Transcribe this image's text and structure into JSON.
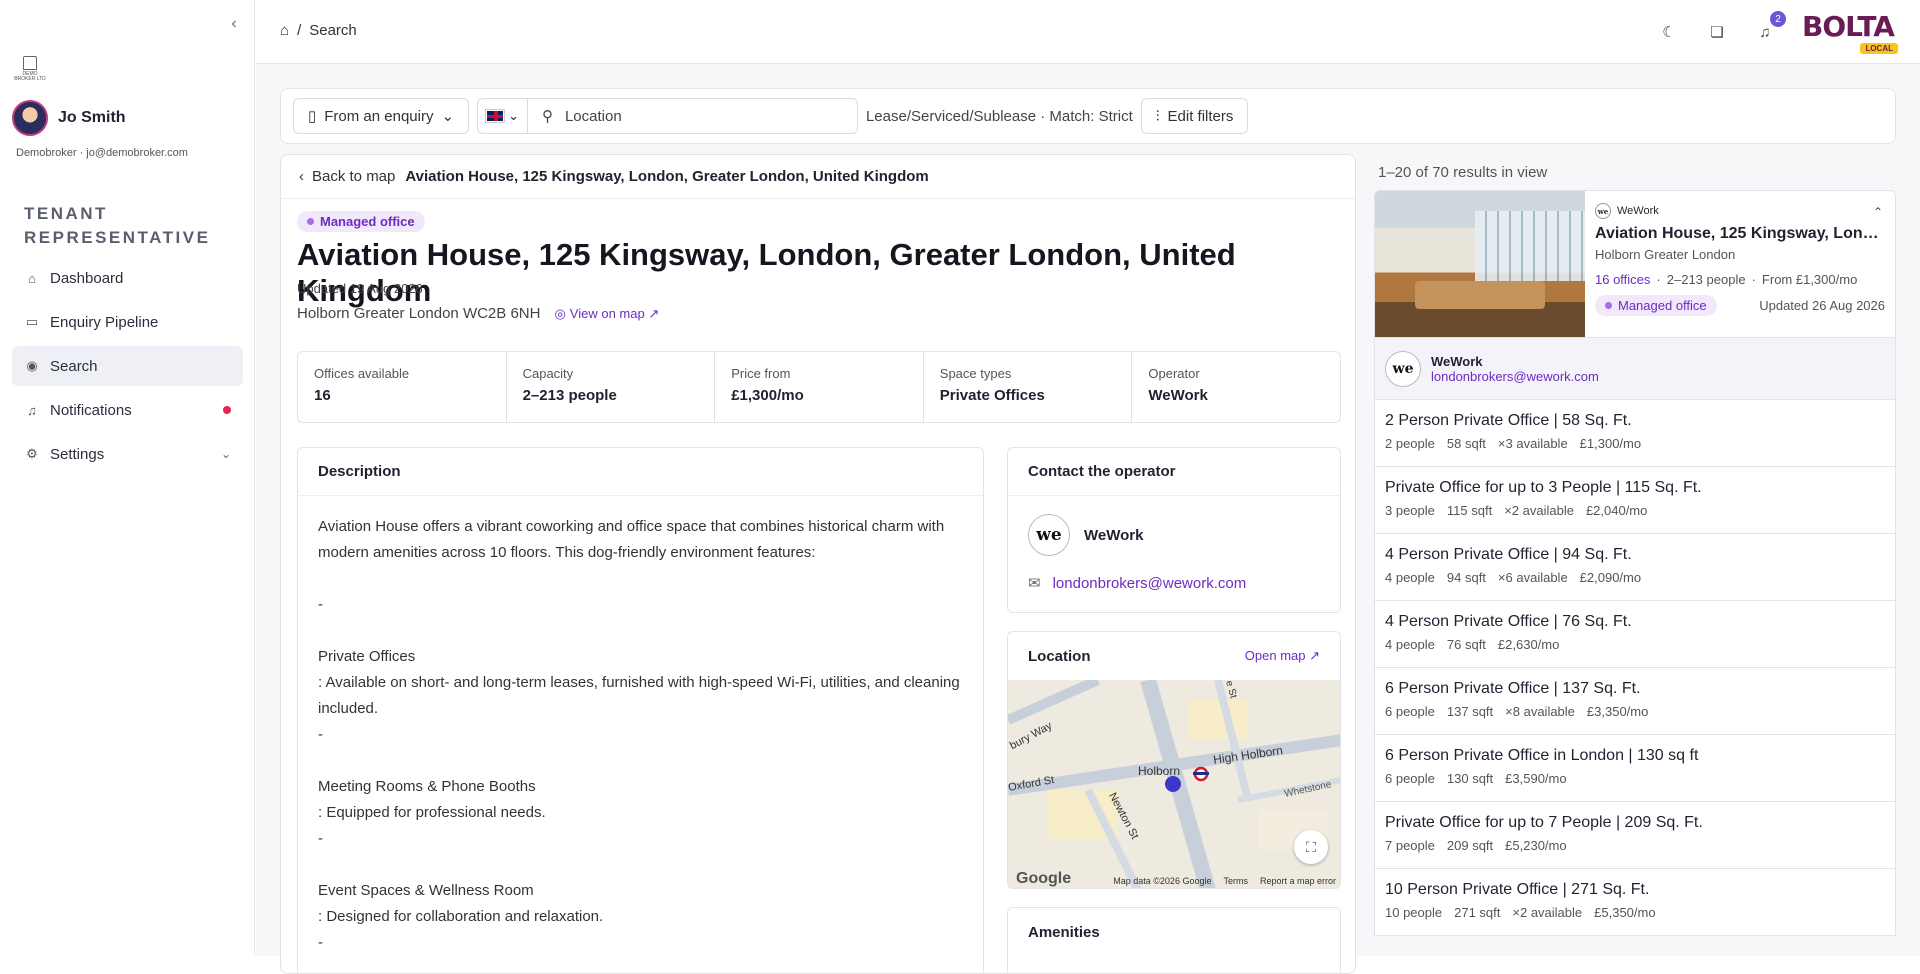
{
  "sidebar": {
    "brand_text": "DEMO BROKER LTD",
    "user_name": "Jo Smith",
    "user_email": "Demobroker · jo@demobroker.com",
    "section_title": "TENANT REPRESENTATIVE",
    "items": [
      {
        "label": "Dashboard",
        "icon": "home-icon"
      },
      {
        "label": "Enquiry Pipeline",
        "icon": "document-icon"
      },
      {
        "label": "Search",
        "icon": "location-pin-icon"
      },
      {
        "label": "Notifications",
        "icon": "bell-icon"
      },
      {
        "label": "Settings",
        "icon": "gear-icon"
      }
    ]
  },
  "topbar": {
    "breadcrumb_current": "Search",
    "notification_count": "2",
    "logo_word": "BOLTA",
    "logo_badge": "LOCAL"
  },
  "filters": {
    "enquiry_label": "From an enquiry",
    "location_placeholder": "Location",
    "summary": "Lease/Serviced/Sublease · Match: Strict",
    "edit_label": "Edit filters"
  },
  "detail": {
    "back_label": "Back to map",
    "back_address": "Aviation House, 125 Kingsway, London, Greater London, United Kingdom",
    "tag": "Managed office",
    "title": "Aviation House, 125 Kingsway, London, Greater London, United Kingdom",
    "updated": "Updated 19 Aug 2026",
    "address": "Holborn Greater London WC2B 6NH",
    "view_map": "View on map ↗",
    "stats": [
      {
        "label": "Offices available",
        "value": "16"
      },
      {
        "label": "Capacity",
        "value": "2–213 people"
      },
      {
        "label": "Price from",
        "value": "£1,300/mo"
      },
      {
        "label": "Space types",
        "value": "Private Offices"
      },
      {
        "label": "Operator",
        "value": "WeWork"
      }
    ],
    "description_title": "Description",
    "description": "Aviation House offers a vibrant coworking and office space that combines historical charm with modern amenities across 10 floors. This dog-friendly environment features:\n\n-\n\nPrivate Offices\n: Available on short- and long-term leases, furnished with high-speed Wi-Fi, utilities, and cleaning included.\n-\n\nMeeting Rooms & Phone Booths\n: Equipped for professional needs.\n-\n\nEvent Spaces & Wellness Room\n: Designed for collaboration and relaxation.\n-",
    "contact_title": "Contact the operator",
    "operator_name": "WeWork",
    "operator_logo": "we",
    "operator_email": "londonbrokers@wework.com",
    "location_title": "Location",
    "open_map": "Open map ↗",
    "map_labels": {
      "street1": "High Holborn",
      "street2": "Newton St",
      "street3": "Holborn",
      "street4": "Oxford St",
      "street5": "Whetstone",
      "street6": "bury Way",
      "street7": "e St",
      "google": "Google",
      "attribution": "Map data ©2026 Google",
      "terms": "Terms",
      "report": "Report a map error"
    },
    "amenities_title": "Amenities"
  },
  "results": {
    "count": "1–20 of 70 results in view",
    "card": {
      "operator": "WeWork",
      "title": "Aviation House, 125 Kingsway, London...",
      "area": "Holborn Greater London",
      "offices": "16 offices",
      "people": "2–213 people",
      "price": "From £1,300/mo",
      "tag": "Managed office",
      "updated": "Updated 26 Aug 2026"
    },
    "operator_strip": {
      "name": "WeWork",
      "email": "londonbrokers@wework.com"
    },
    "listings": [
      {
        "title": "2 Person Private Office | 58 Sq. Ft.",
        "people": "2 people",
        "sqft": "58 sqft",
        "avail": "×3 available",
        "price": "£1,300/mo"
      },
      {
        "title": "Private Office for up to 3 People | 115 Sq. Ft.",
        "people": "3 people",
        "sqft": "115 sqft",
        "avail": "×2 available",
        "price": "£2,040/mo"
      },
      {
        "title": "4 Person Private Office | 94 Sq. Ft.",
        "people": "4 people",
        "sqft": "94 sqft",
        "avail": "×6 available",
        "price": "£2,090/mo"
      },
      {
        "title": "4 Person Private Office | 76 Sq. Ft.",
        "people": "4 people",
        "sqft": "76 sqft",
        "avail": "",
        "price": "£2,630/mo"
      },
      {
        "title": "6 Person Private Office | 137 Sq. Ft.",
        "people": "6 people",
        "sqft": "137 sqft",
        "avail": "×8 available",
        "price": "£3,350/mo"
      },
      {
        "title": "6 Person Private Office in London | 130 sq ft",
        "people": "6 people",
        "sqft": "130 sqft",
        "avail": "",
        "price": "£3,590/mo"
      },
      {
        "title": "Private Office for up to 7 People | 209 Sq. Ft.",
        "people": "7 people",
        "sqft": "209 sqft",
        "avail": "",
        "price": "£5,230/mo"
      },
      {
        "title": "10 Person Private Office | 271 Sq. Ft.",
        "people": "10 people",
        "sqft": "271 sqft",
        "avail": "×2 available",
        "price": "£5,350/mo"
      }
    ]
  }
}
